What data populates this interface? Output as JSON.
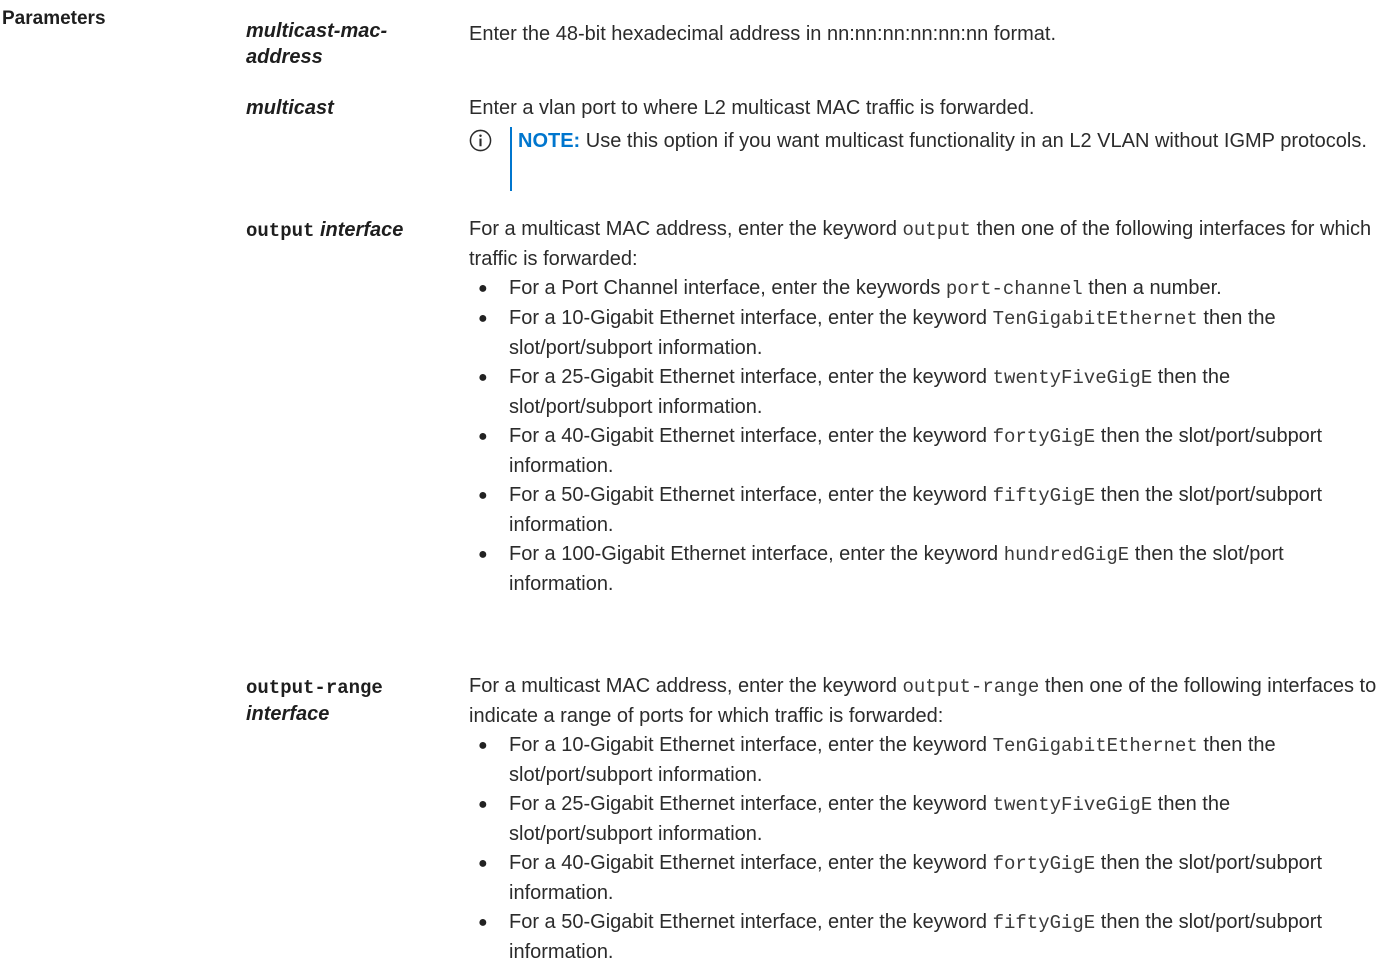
{
  "section_label": "Parameters",
  "params": [
    {
      "term_italic_1": "multicast-mac-",
      "term_italic_2": "address",
      "desc": "Enter the 48-bit hexadecimal address in nn:nn:nn:nn:nn:nn format."
    },
    {
      "term_italic": "multicast",
      "desc": "Enter a vlan port to where L2 multicast MAC traffic is forwarded.",
      "note_label": "NOTE:",
      "note_text": " Use this option if you want multicast functionality in an L2 VLAN without IGMP protocols."
    },
    {
      "term_mono": "output",
      "term_italic": "interface",
      "desc_pre": "For a multicast MAC address, enter the keyword ",
      "desc_code": "output",
      "desc_post": " then one of the following interfaces for which traffic is forwarded:",
      "bullets": [
        {
          "pre": "For a Port Channel interface, enter the keywords ",
          "code": "port-channel",
          "post": " then a number."
        },
        {
          "pre": "For a 10-Gigabit Ethernet interface, enter the keyword ",
          "code": "TenGigabitEthernet",
          "post": " then the slot/port/subport information."
        },
        {
          "pre": "For a 25-Gigabit Ethernet interface, enter the keyword ",
          "code": "twentyFiveGigE",
          "post": " then the slot/port/subport information."
        },
        {
          "pre": "For a 40-Gigabit Ethernet interface, enter the keyword ",
          "code": "fortyGigE",
          "post": " then the slot/port/subport information."
        },
        {
          "pre": "For a 50-Gigabit Ethernet interface, enter the keyword ",
          "code": "fiftyGigE",
          "post": " then the slot/port/subport information."
        },
        {
          "pre": "For a 100-Gigabit Ethernet interface, enter the keyword ",
          "code": "hundredGigE",
          "post": " then the slot/port information."
        }
      ]
    },
    {
      "term_mono": "output-range",
      "term_italic": "interface",
      "desc_pre": "For a multicast MAC address, enter the keyword ",
      "desc_code": "output-range",
      "desc_post": " then one of the following interfaces to indicate a range of ports for which traffic is forwarded:",
      "bullets": [
        {
          "pre": "For a 10-Gigabit Ethernet interface, enter the keyword ",
          "code": "TenGigabitEthernet",
          "post": " then the slot/port/subport information."
        },
        {
          "pre": "For a 25-Gigabit Ethernet interface, enter the keyword ",
          "code": "twentyFiveGigE",
          "post": " then the slot/port/subport information."
        },
        {
          "pre": "For a 40-Gigabit Ethernet interface, enter the keyword ",
          "code": "fortyGigE",
          "post": " then the slot/port/subport information."
        },
        {
          "pre": "For a 50-Gigabit Ethernet interface, enter the keyword ",
          "code": "fiftyGigE",
          "post": " then the slot/port/subport information."
        }
      ]
    }
  ],
  "bullet_glyph": "●",
  "icons": {
    "note": "info-circle-icon",
    "note_color": "#0076ce"
  }
}
